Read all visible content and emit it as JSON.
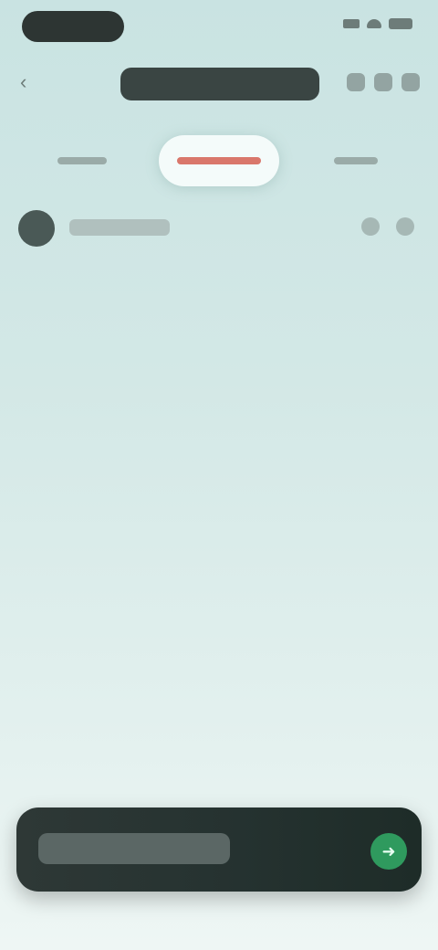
{
  "status": {
    "pill": ""
  },
  "header": {
    "title": ""
  },
  "tabs": [
    {
      "label": ""
    },
    {
      "label": ""
    },
    {
      "label": ""
    }
  ],
  "bottom": {
    "title": ""
  },
  "icons": {
    "back": "chevron-left-icon",
    "go": "arrow-right-icon"
  },
  "colors": {
    "active_tab_text": "#c0392b",
    "go_button": "#2f9a5e"
  }
}
